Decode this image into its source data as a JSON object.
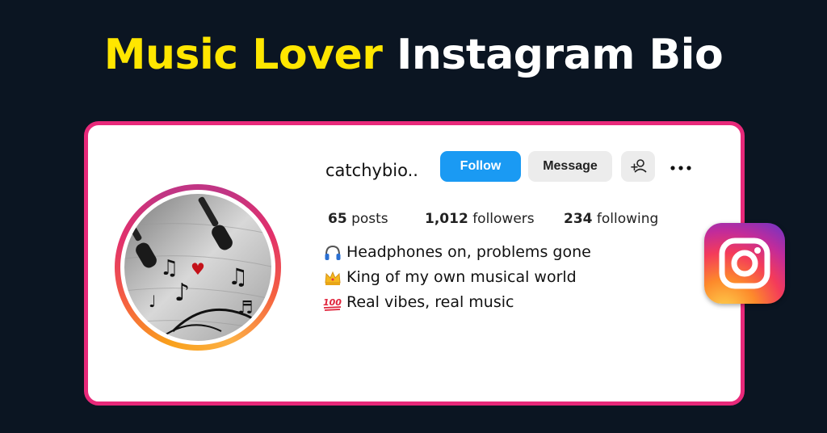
{
  "headline": {
    "part1": "Music Lover",
    "part2": "Instagram Bio"
  },
  "colors": {
    "background": "#0b1522",
    "headline_accent": "#ffe600",
    "card_border": "#e8297a",
    "follow_button": "#1a9af3"
  },
  "profile": {
    "username": "catchybio..",
    "buttons": {
      "follow": "Follow",
      "message": "Message",
      "add_user_icon": "+👤"
    },
    "more_icon": "more-dots-icon",
    "stats": {
      "posts": {
        "count": "65",
        "label": "posts"
      },
      "followers": {
        "count": "1,012",
        "label": "followers"
      },
      "following": {
        "count": "234",
        "label": "following"
      }
    },
    "bio": [
      {
        "icon": "headphones-icon",
        "text": "Headphones on, problems gone"
      },
      {
        "icon": "crown-icon",
        "text": "King of my own musical world"
      },
      {
        "icon": "hundred-points-icon",
        "text": "Real vibes, real music"
      }
    ]
  },
  "logo": "instagram-logo-icon"
}
